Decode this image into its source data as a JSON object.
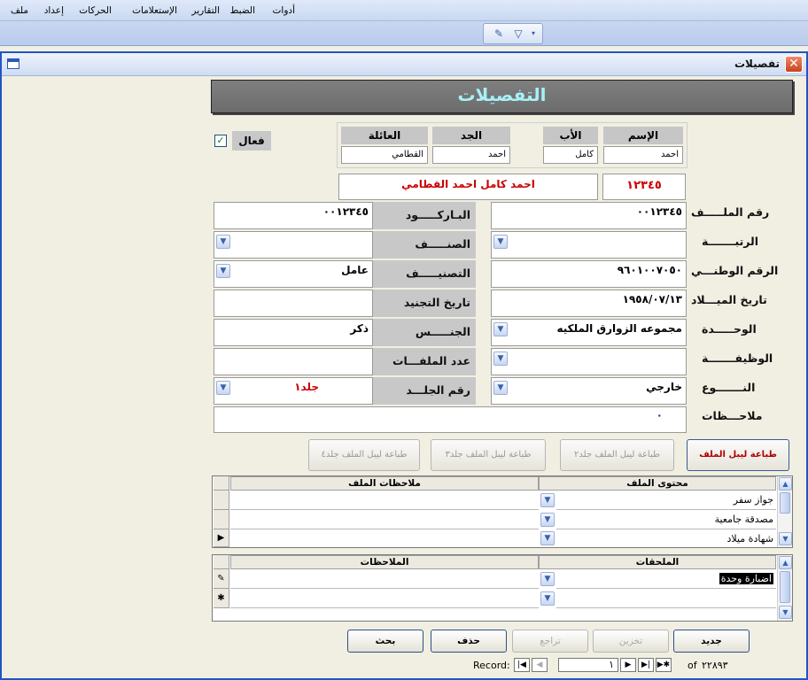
{
  "menubar": {
    "items": [
      "ملف",
      "إعداد",
      "الحركات",
      "الإستعلامات",
      "التقارير",
      "الضبط",
      "أدوات"
    ]
  },
  "toolbar": {
    "icons": [
      "filter-edit-icon",
      "filter-icon",
      "dropdown-arrow-icon"
    ]
  },
  "window": {
    "title": "تفصيلات",
    "close": "✕"
  },
  "form": {
    "title": "التفصيلات",
    "active_label": "فعال",
    "active_checked": true,
    "name_parts": {
      "first_label": "الإسم",
      "first": "احمد",
      "father_label": "الأب",
      "father": "كامل",
      "grandfather_label": "الجد",
      "grandfather": "احمد",
      "family_label": "العائلة",
      "family": "القطامي"
    },
    "full_name": "احمد كامل احمد القطامي",
    "code": "١٢٣٤٥",
    "fields": {
      "file_no_label": "رقم الملـــــف",
      "file_no": "٠٠١٢٣٤٥",
      "barcode_label": "البـاركـــــود",
      "barcode": "٠٠١٢٣٤٥",
      "rank_label": "الرتبـــــــة",
      "rank": "",
      "category_label": "الصنـــــف",
      "category": "",
      "national_id_label": "الرقم الوطنـــي",
      "national_id": "٩٦٠١٠٠٧٠٥٠",
      "classification_label": "التصنيـــــف",
      "classification": "عامل",
      "birth_date_label": "تاريخ الميـــلاد",
      "birth_date": "١٩٥٨/٠٧/١٣",
      "enlist_date_label": "تاريخ التجنيد",
      "enlist_date": "",
      "unit_label": "الوحـــــدة",
      "unit": "مجموعه الزوارق الملكيه",
      "gender_label": "الجنـــــس",
      "gender": "ذكر",
      "job_label": "الوظيفـــــــة",
      "job": "",
      "files_count_label": "عدد الملفـــات",
      "files_count": "",
      "type_label": "النـــــــوع",
      "type": "خارجي",
      "volume_label": "رقم الجلـــد",
      "volume": "جلد١",
      "notes_label": "ملاحـــظات",
      "notes": "٠"
    },
    "print_buttons": [
      "طباعة ليبل الملف جلد١",
      "طباعة ليبل الملف جلد٢",
      "طباعة ليبل الملف جلد٣",
      "طباعة ليبل الملف جلد٤"
    ],
    "contents_grid": {
      "col_content": "محتوى الملف",
      "col_notes": "ملاحظات الملف",
      "rows": [
        {
          "content": "جواز سفر",
          "notes": ""
        },
        {
          "content": "مصدقة جامعية",
          "notes": ""
        },
        {
          "content": "شهادة ميلاد",
          "notes": ""
        }
      ]
    },
    "attachments_grid": {
      "col_attach": "الملحقات",
      "col_notes": "الملاحظات",
      "rows": [
        {
          "attach": "اضبارة وحدة",
          "notes": ""
        },
        {
          "attach": "",
          "notes": ""
        }
      ]
    },
    "nav_buttons": {
      "new": "جديد",
      "save": "تخزين",
      "undo": "تراجع",
      "delete": "حذف",
      "search": "بحث"
    },
    "record_nav": {
      "label": "Record:",
      "current": "١",
      "of_label": "of",
      "total": "٢٢٨٩٣"
    }
  }
}
